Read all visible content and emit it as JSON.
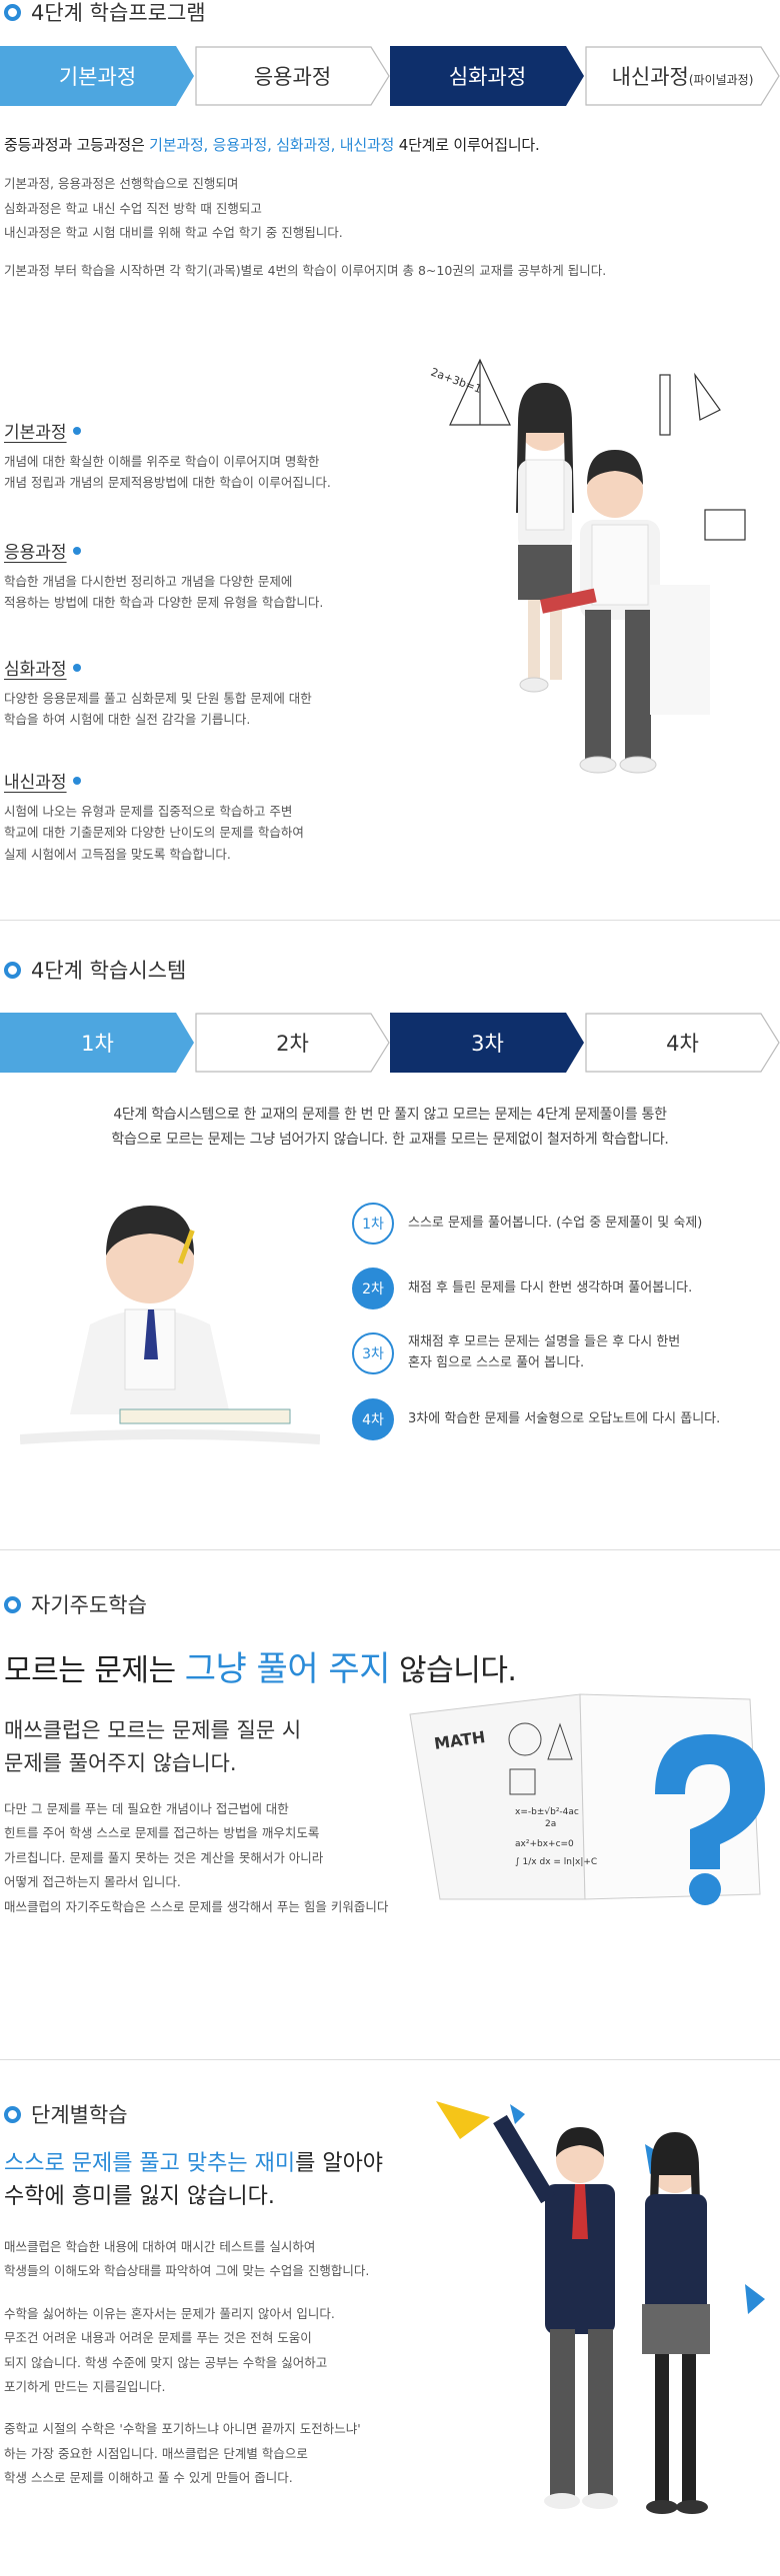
{
  "program": {
    "title": "4단계 학습프로그램",
    "tabs": [
      "기본과정",
      "응용과정",
      "심화과정",
      "내신과정"
    ],
    "tab4_small": "(파이널과정)",
    "lead_prefix": "중등과정과 고등과정은 ",
    "lead_highlight": "기본과정, 응용과정, 심화과정, 내신과정",
    "lead_suffix": " 4단계로 이루어집니다.",
    "lines": [
      "기본과정, 응용과정은 선행학습으로 진행되며",
      "심화과정은 학교 내신 수업 직전 방학 때 진행되고",
      "내신과정은 학교 시험 대비를 위해 학교 수업 학기 중 진행됩니다."
    ],
    "summary": "기본과정 부터 학습을 시작하면 각 학기(과목)별로 4번의 학습이 이루어지며 총 8~10권의 교재를 공부하게 됩니다.",
    "items": [
      {
        "title": "기본과정",
        "text": "개념에 대한 확실한 이해를 위주로 학습이 이루어지며 명확한\n개념 정립과 개념의 문제적용방법에 대한 학습이 이루어집니다."
      },
      {
        "title": "응용과정",
        "text": "학습한 개념을 다시한번 정리하고 개념을 다양한 문제에\n적용하는 방법에 대한 학습과 다양한 문제 유형을 학습합니다."
      },
      {
        "title": "심화과정",
        "text": "다양한 응용문제를 풀고 심화문제 및 단원 통합 문제에 대한\n학습을 하여 시험에 대한 실전 감각을 기릅니다."
      },
      {
        "title": "내신과정",
        "text": "시험에 나오는 유형과 문제를 집중적으로 학습하고 주변\n학교에 대한 기출문제와 다양한 난이도의 문제를 학습하여\n실제 시험에서 고득점을 맞도록 학습합니다."
      }
    ]
  },
  "system": {
    "title": "4단계 학습시스템",
    "tabs": [
      "1차",
      "2차",
      "3차",
      "4차"
    ],
    "intro": "4단계 학습시스템으로 한 교재의 문제를 한 번 만 풀지 않고 모르는 문제는 4단계 문제풀이를 통한\n학습으로 모르는 문제는 그냥 넘어가지 않습니다. 한 교재를 모르는 문제없이 철저하게 학습합니다.",
    "steps": [
      {
        "label": "1차",
        "text": "스스로 문제를 풀어봅니다. (수업 중 문제풀이 및 숙제)"
      },
      {
        "label": "2차",
        "text": "채점 후 틀린 문제를 다시 한번 생각하며 풀어봅니다."
      },
      {
        "label": "3차",
        "text": "재채점 후 모르는 문제는 설명을 들은 후 다시 한번\n혼자 힘으로 스스로 풀어 봅니다."
      },
      {
        "label": "4차",
        "text": "3차에 학습한 문제를 서술형으로 오답노트에 다시 풉니다."
      }
    ]
  },
  "self": {
    "title": "자기주도학습",
    "heading_a": "모르는 문제는 ",
    "heading_b": "그냥 풀어 주지",
    "heading_c": " 않습니다.",
    "sub": "매쓰클럽은 모르는 문제를 질문 시\n문제를 풀어주지 않습니다.",
    "body": "다만 그 문제를 푸는 데 필요한 개념이나 접근법에 대한\n힌트를 주어 학생 스스로 문제를 접근하는 방법을 깨우치도록\n가르칩니다. 문제를 풀지 못하는 것은 계산을 못해서가 아니라\n어떻게 접근하는지 몰라서 입니다.\n매쓰클럽의 자기주도학습은 스스로 문제를 생각해서 푸는 힘을 키워줍니다",
    "book_word": "MATH"
  },
  "level": {
    "title": "단계별학습",
    "heading_blue": "스스로 문제를 풀고 맞추는 재미",
    "heading_rest": "를 알아야",
    "heading_line2": "수학에 흥미를 잃지 않습니다.",
    "p1": "매쓰클럽은 학습한 내용에 대하여 매시간 테스트를 실시하여\n학생들의 이해도와 학습상태를 파악하여 그에 맞는 수업을 진행합니다.",
    "p2": "수학을 싫어하는 이유는 혼자서는 문제가 풀리지 않아서 입니다.\n무조건 어려운 내용과 어려운 문제를 푸는 것은 전혀 도움이\n되지 않습니다. 학생 수준에 맞지 않는 공부는 수학을 싫어하고\n포기하게 만드는 지름길입니다.",
    "p3": "중학교 시절의 수학은 '수학을 포기하느냐 아니면 끝까지 도전하느냐'\n하는 가장 중요한 시점입니다. 매쓰클럽은 단계별 학습으로\n학생 스스로 문제를 이해하고 풀 수 있게 만들어 줍니다."
  },
  "colors": {
    "accent": "#2a8bd8",
    "light_tab": "#4da6e0",
    "dark_tab": "#0e2f6b"
  }
}
